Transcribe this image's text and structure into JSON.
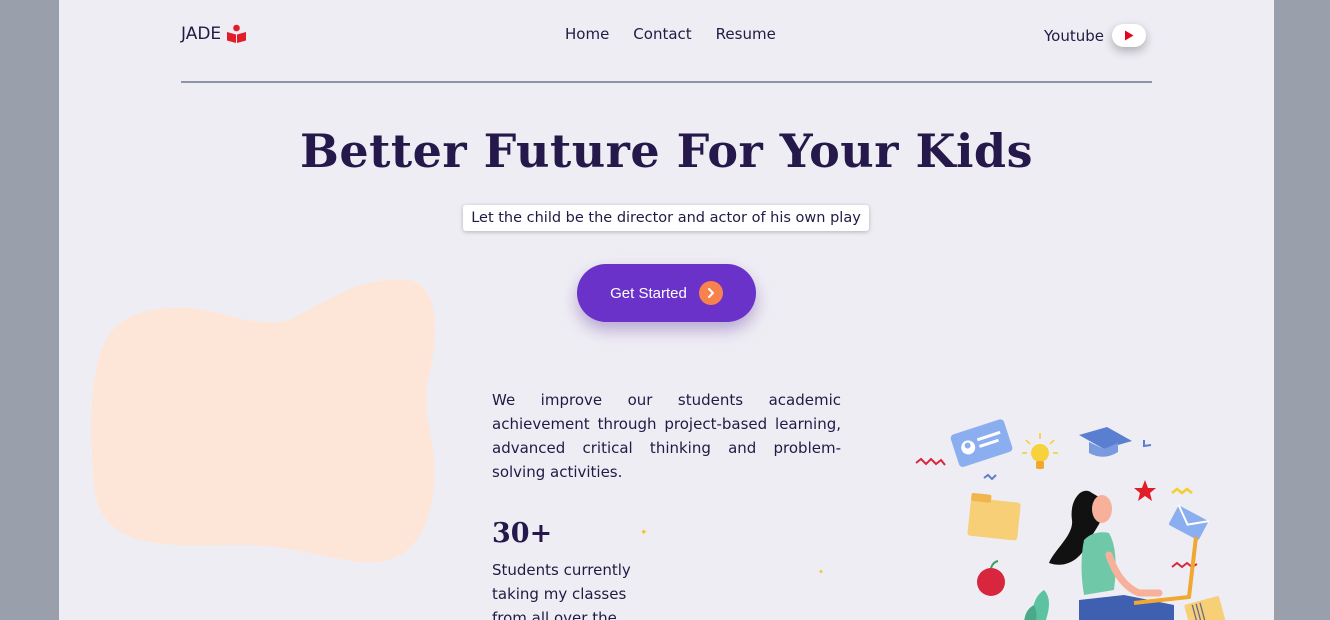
{
  "header": {
    "logo_text": "JADE",
    "logo_icon": "book-reader-icon",
    "nav": [
      {
        "label": "Home"
      },
      {
        "label": "Contact"
      },
      {
        "label": "Resume"
      }
    ],
    "youtube_label": "Youtube",
    "youtube_icon": "youtube-play-icon"
  },
  "hero": {
    "title": "Better Future For Your Kids",
    "tagline": "Let the child be the director and actor of his own play",
    "cta_label": "Get Started",
    "cta_icon": "chevron-right-icon"
  },
  "about": {
    "text": "We improve our students academic achievement through project-based learning, advanced critical thinking and problem-solving activities."
  },
  "stats": {
    "number": "30+",
    "text": "Students currently taking my classes from all over the"
  },
  "colors": {
    "accent": "#6a32c8",
    "cta_icon_bg": "#f7824d",
    "title": "#24194a",
    "blob": "#fde6d8",
    "background": "#efedf4",
    "brand_red": "#e11d2a"
  }
}
